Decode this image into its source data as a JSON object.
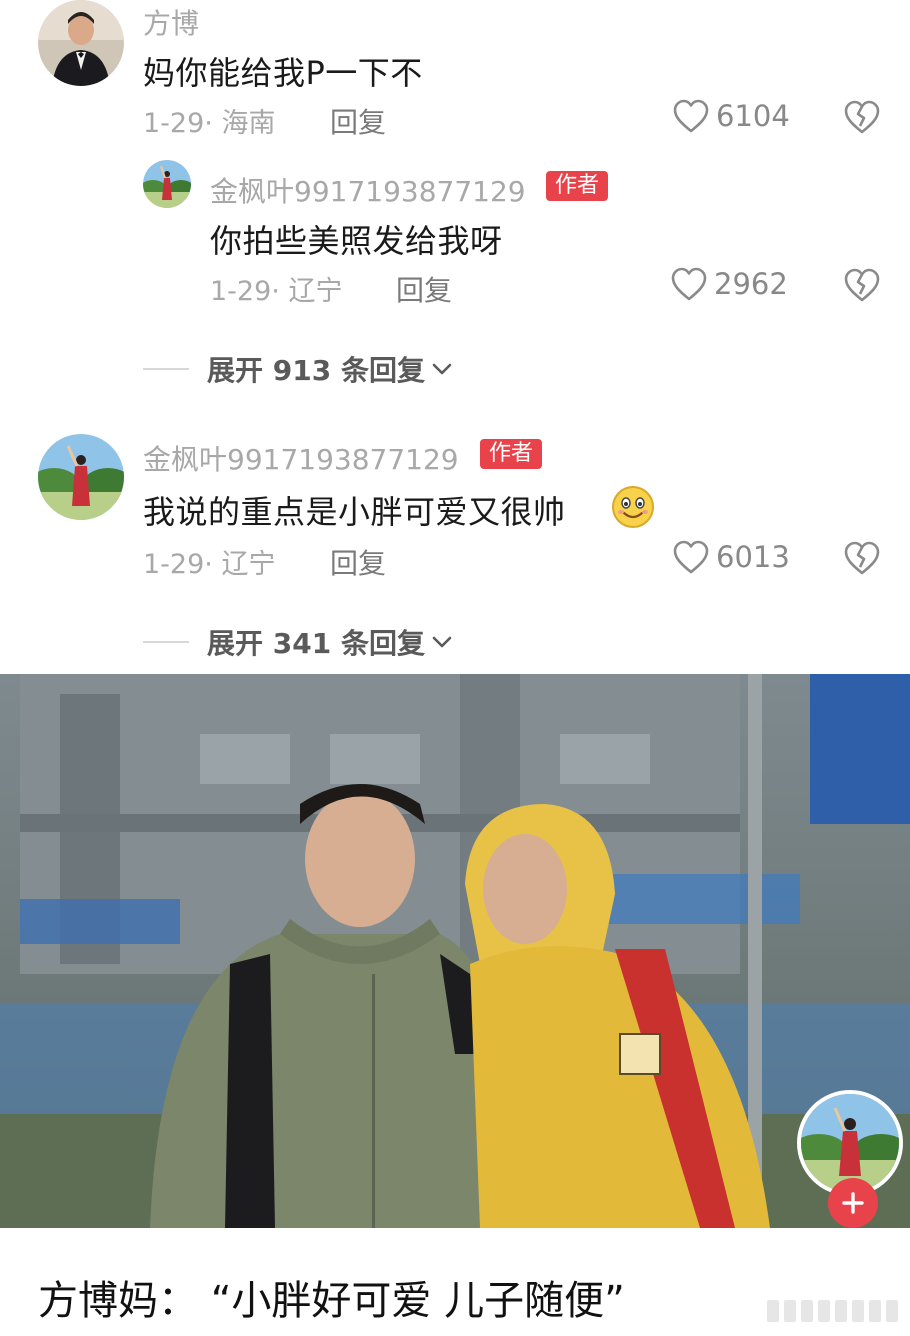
{
  "comments": [
    {
      "name": "方博",
      "text": "妈你能给我P一下不",
      "date": "1-29",
      "location": "海南",
      "reply_label": "回复",
      "likes": "6104",
      "avatar_icon": "man-in-suit-avatar"
    },
    {
      "name": "金枫叶9917193877129",
      "badge": "作者",
      "text": "你拍些美照发给我呀",
      "date": "1-29",
      "location": "辽宁",
      "reply_label": "回复",
      "likes": "2962",
      "avatar_icon": "dancer-landscape-avatar"
    },
    {
      "name": "金枫叶9917193877129",
      "badge": "作者",
      "text": "我说的重点是小胖可爱又很帅",
      "emoji": "smiling-face-emoji",
      "date": "1-29",
      "location": "辽宁",
      "reply_label": "回复",
      "likes": "6013",
      "avatar_icon": "dancer-landscape-avatar"
    }
  ],
  "expand_1": "展开 913 条回复",
  "expand_2": "展开 341 条回复",
  "caption": "方博妈：  “小胖好可爱 儿子随便”",
  "icons": {
    "like": "heart-outline-icon",
    "dislike": "broken-heart-icon",
    "expand_arrow": "chevron-down-icon",
    "follow": "plus-icon"
  },
  "colors": {
    "badge": "#e8424a",
    "follow_button": "#e8424a",
    "meta_text": "#a8a8a8"
  }
}
